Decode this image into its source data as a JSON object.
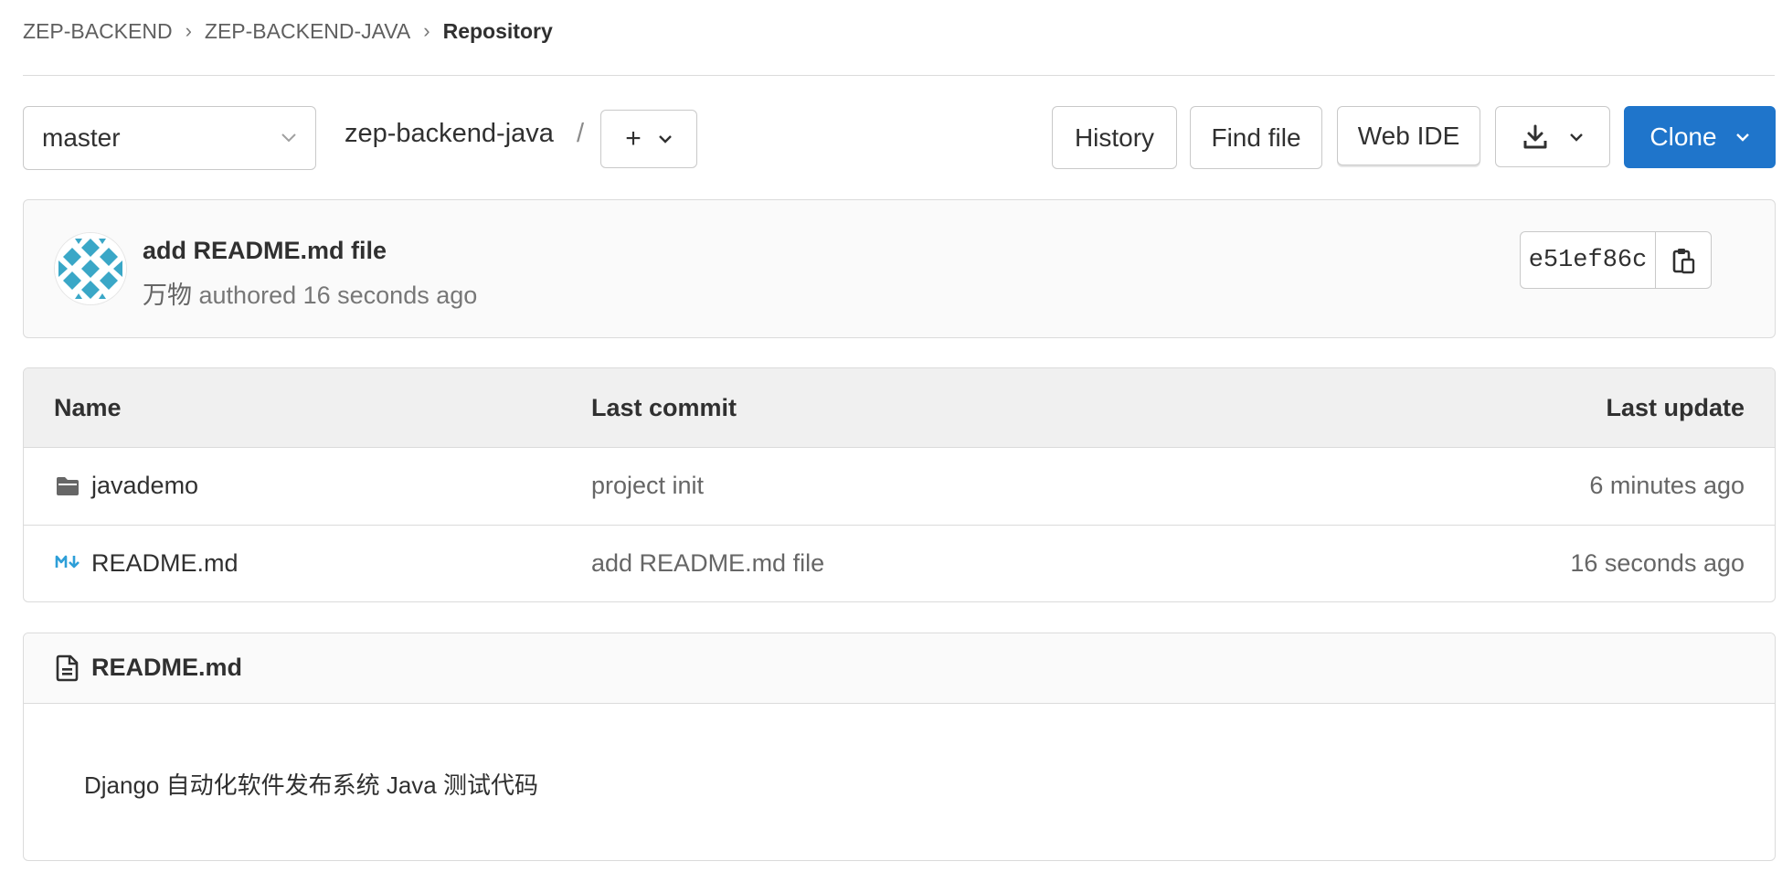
{
  "breadcrumb": {
    "items": [
      "ZEP-BACKEND",
      "ZEP-BACKEND-JAVA"
    ],
    "current": "Repository",
    "separator": "›"
  },
  "toolbar": {
    "branch": "master",
    "path": "zep-backend-java",
    "path_separator": "/",
    "add_label": "+",
    "history_label": "History",
    "find_file_label": "Find file",
    "web_ide_label": "Web IDE",
    "clone_label": "Clone",
    "download_icon": "download-icon",
    "clone_color": "#1f75cb"
  },
  "commit": {
    "title": "add README.md file",
    "author": "万物",
    "meta": "authored 16 seconds ago",
    "sha": "e51ef86c",
    "copy_icon": "clipboard-icon"
  },
  "files": {
    "headers": {
      "name": "Name",
      "last_commit": "Last commit",
      "last_update": "Last update"
    },
    "rows": [
      {
        "icon": "folder-icon",
        "name": "javademo",
        "last_commit": "project init",
        "last_update": "6 minutes ago"
      },
      {
        "icon": "markdown-icon",
        "name": "README.md",
        "last_commit": "add README.md file",
        "last_update": "16 seconds ago"
      }
    ]
  },
  "readme": {
    "title": "README.md",
    "content": "Django 自动化软件发布系统 Java 测试代码"
  }
}
